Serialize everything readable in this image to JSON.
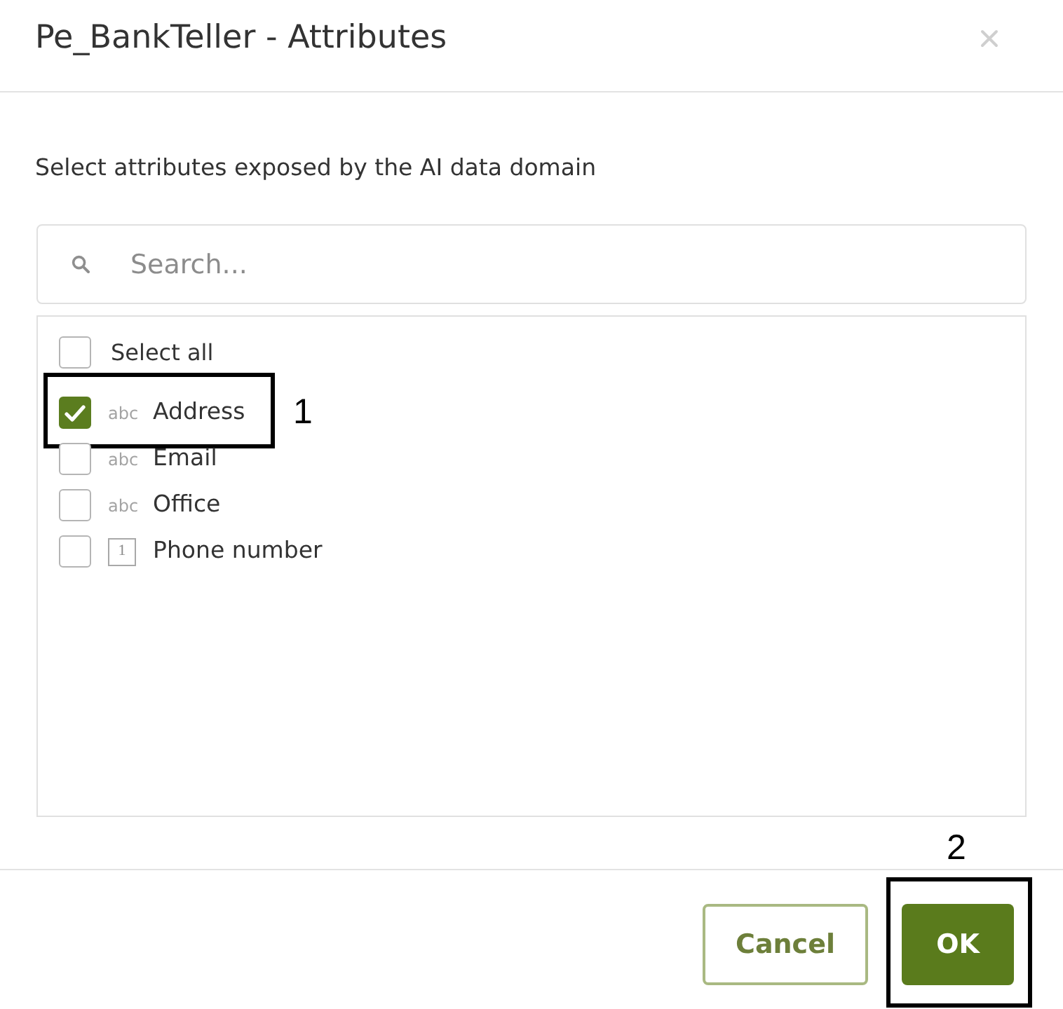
{
  "dialog": {
    "title": "Pe_BankTeller - Attributes"
  },
  "instruction": "Select attributes exposed by the AI data domain",
  "search": {
    "placeholder": "Search..."
  },
  "select_all": {
    "label": "Select all",
    "checked": false
  },
  "attributes": [
    {
      "label": "Address",
      "checked": true,
      "kind": "text",
      "type_label": "abc",
      "callout": "1"
    },
    {
      "label": "Email",
      "checked": false,
      "kind": "text",
      "type_label": "abc"
    },
    {
      "label": "Office",
      "checked": false,
      "kind": "text",
      "type_label": "abc"
    },
    {
      "label": "Phone number",
      "checked": false,
      "kind": "number",
      "type_label": "1"
    }
  ],
  "buttons": [
    {
      "label": "Cancel",
      "kind": "secondary"
    },
    {
      "label": "OK",
      "kind": "primary",
      "callout": "2"
    }
  ]
}
